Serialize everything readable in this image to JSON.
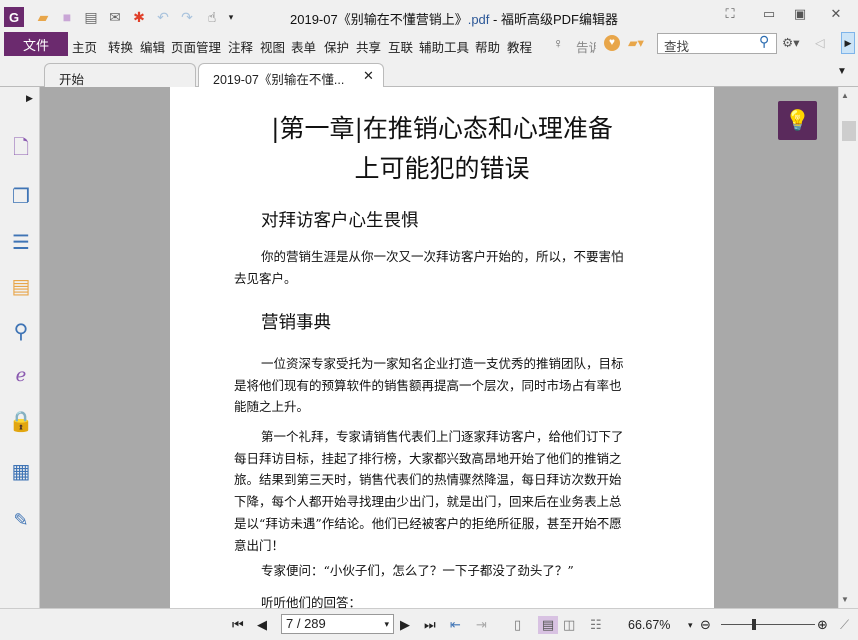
{
  "window": {
    "title_prefix": "2019-07《别输在不懂营销上》",
    "title_ext": ".pdf",
    "title_suffix": " - 福昕高级PDF编辑器"
  },
  "quick_access": [
    "app-logo-icon",
    "open-folder-icon",
    "save-icon",
    "print-icon",
    "email-icon",
    "new-icon",
    "undo-icon",
    "redo-icon",
    "hand-tool-icon",
    "customize-icon"
  ],
  "menu": {
    "file": "文件",
    "items": [
      "主页",
      "转换",
      "编辑",
      "页面管理",
      "注释",
      "视图",
      "表单",
      "保护",
      "共享",
      "互联",
      "辅助工具",
      "帮助",
      "教程"
    ],
    "tell_me": "告诉",
    "search_placeholder": "查找"
  },
  "tabs": [
    {
      "label": "开始"
    },
    {
      "label": "2019-07《别输在不懂..."
    }
  ],
  "sidebar": [
    "bookmark-icon",
    "pages-icon",
    "layers-icon",
    "comments-icon",
    "attachments-icon",
    "signature-icon",
    "security-icon",
    "form-fields-icon",
    "certify-icon"
  ],
  "document": {
    "chapter_line1": "|第一章|在推销心态和心理准备",
    "chapter_line2": "上可能犯的错误",
    "h_fear": "对拜访客户心生畏惧",
    "p1": [
      "你的营销生涯是从你一次又一次拜访客户开始的，所以，不要害怕",
      "去见客户。"
    ],
    "h_story": "营销事典",
    "p2": [
      "一位资深专家受托为一家知名企业打造一支优秀的推销团队，目标",
      "是将他们现有的预算软件的销售额再提高一个层次，同时市场占有率也",
      "能随之上升。"
    ],
    "p3": [
      "第一个礼拜，专家请销售代表们上门逐家拜访客户，给他们订下了",
      "每日拜访目标，挂起了排行榜，大家都兴致高昂地开始了他们的推销之",
      "旅。结果到第三天时，销售代表们的热情骤然降温，每日拜访次数开始",
      "下降，每个人都开始寻找理由少出门，就是出门，回来后在业务表上总",
      "是以“拜访未遇”作结论。他们已经被客户的拒绝所征服，甚至开始不愿",
      "意出门！"
    ],
    "p4": [
      "专家便问：“小伙子们，怎么了？一下子都没了劲头了？”"
    ],
    "p5": [
      "听听他们的回答："
    ]
  },
  "status": {
    "page": "7 / 289",
    "zoom": "66.67%",
    "zoom_slider_percent": 50
  },
  "colors": {
    "accent": "#6b2a6e",
    "page_bg": "#ffffff",
    "viewer_bg": "#a9a9a9"
  }
}
